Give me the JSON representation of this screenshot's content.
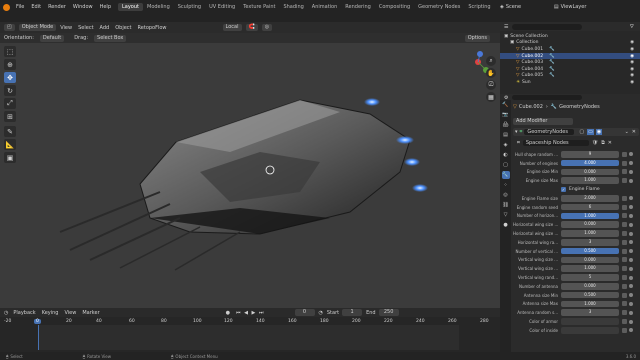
{
  "topbar": {
    "menus": [
      "File",
      "Edit",
      "Render",
      "Window",
      "Help"
    ],
    "workspaces": [
      "Layout",
      "Modeling",
      "Sculpting",
      "UV Editing",
      "Texture Paint",
      "Shading",
      "Animation",
      "Rendering",
      "Compositing",
      "Geometry Nodes",
      "Scripting"
    ],
    "active_workspace": "Layout",
    "scene": "Scene",
    "view_layer": "ViewLayer"
  },
  "viewport_header": {
    "mode": "Object Mode",
    "menus": [
      "View",
      "Select",
      "Add",
      "Object"
    ],
    "retopoflow": "RetopoFlow",
    "transform": "Local",
    "options": "Options"
  },
  "tool_settings": {
    "orientation_label": "Orientation:",
    "orientation_value": "Default",
    "drag_label": "Drag:",
    "drag_value": "Select Box"
  },
  "timeline": {
    "menus": [
      "Playback",
      "Keying",
      "View",
      "Marker"
    ],
    "current_frame": "0",
    "start_label": "Start",
    "start_value": "1",
    "end_label": "End",
    "end_value": "250",
    "ticks": [
      "-20",
      "0",
      "20",
      "40",
      "60",
      "80",
      "100",
      "120",
      "140",
      "160",
      "180",
      "200",
      "220",
      "240",
      "260",
      "280"
    ]
  },
  "statusbar": {
    "select": "Select",
    "rotate": "Rotate View",
    "context": "Object Context Menu",
    "version": "3.6.0"
  },
  "outliner": {
    "items": [
      {
        "label": "Scene Collection",
        "indent": 0
      },
      {
        "label": "Collection",
        "indent": 1
      },
      {
        "label": "Cube.001",
        "indent": 2
      },
      {
        "label": "Cube.002",
        "indent": 2,
        "selected": true
      },
      {
        "label": "Cube.003",
        "indent": 2
      },
      {
        "label": "Cube.004",
        "indent": 2
      },
      {
        "label": "Cube.005",
        "indent": 2
      },
      {
        "label": "Sun",
        "indent": 2
      }
    ]
  },
  "properties": {
    "object": "Cube.002",
    "modifier_name": "GeometryNodes",
    "add_modifier": "Add Modifier",
    "node_group": "Spaceship Nodes",
    "checkbox_label": "Engine Flame",
    "fields": [
      {
        "label": "Hull shape random ...",
        "value": "9"
      },
      {
        "label": "Number of engines",
        "value": "4.000",
        "blue": true
      },
      {
        "label": "Engine size Min",
        "value": "0.000"
      },
      {
        "label": "Engine size Max",
        "value": "1.000"
      },
      {
        "label": "__checkbox__",
        "value": ""
      },
      {
        "label": "Engine Flame size",
        "value": "2.000"
      },
      {
        "label": "Engine random seed",
        "value": "6"
      },
      {
        "label": "Number of horizon...",
        "value": "1.000",
        "blue": true
      },
      {
        "label": "Horizontal wing size ...",
        "value": "0.000"
      },
      {
        "label": "Horizontal wing size ...",
        "value": "1.000"
      },
      {
        "label": "Horizontal wing ra...",
        "value": "3"
      },
      {
        "label": "Number of vertical ...",
        "value": "0.500",
        "blue": true
      },
      {
        "label": "Vertical wing size ...",
        "value": "0.000"
      },
      {
        "label": "Vertical wing size ...",
        "value": "1.000"
      },
      {
        "label": "Vertical wing rand...",
        "value": "5"
      },
      {
        "label": "Number of antenna",
        "value": "0.000"
      },
      {
        "label": "Antenna size Min",
        "value": "0.500"
      },
      {
        "label": "Antenna size Max",
        "value": "1.000"
      },
      {
        "label": "Antenna random s...",
        "value": "3"
      },
      {
        "label": "Color of armor",
        "value": "",
        "dark": true
      },
      {
        "label": "Color of inside",
        "value": "",
        "dark": true
      }
    ]
  },
  "icons": [
    "select-box-icon",
    "cursor-icon",
    "move-icon",
    "rotate-icon",
    "scale-icon",
    "transform-icon",
    "annotate-icon",
    "measure-icon",
    "add-cube-icon",
    "zoom-icon",
    "hand-icon",
    "camera-icon",
    "grid-icon"
  ],
  "colors": {
    "accent": "#4772b3",
    "selected_row": "#334d80",
    "viewport_bg": "#3b3b3b"
  }
}
